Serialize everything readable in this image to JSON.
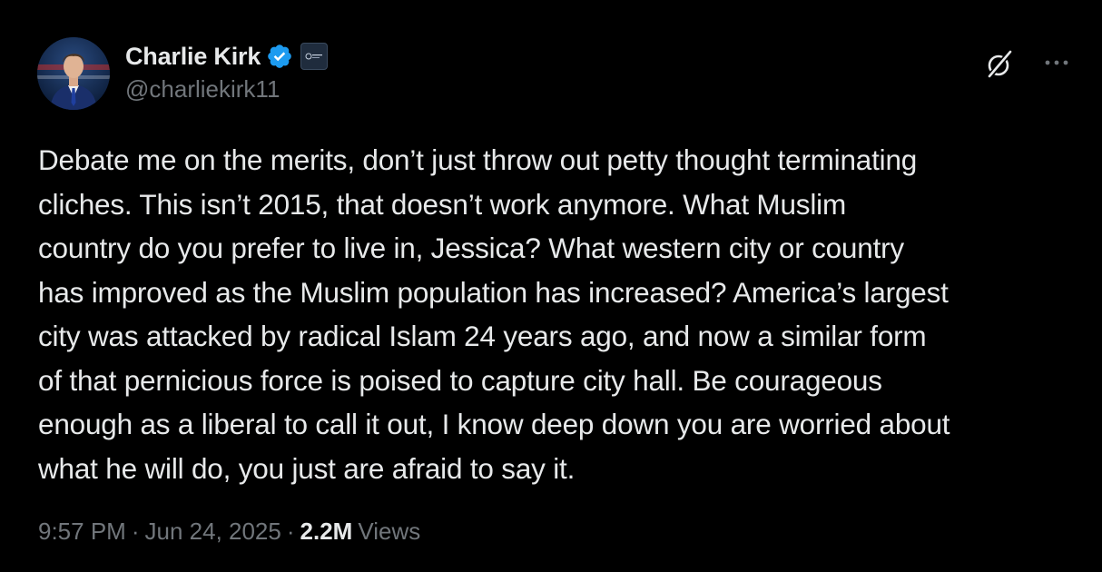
{
  "author": {
    "display_name": "Charlie Kirk",
    "handle": "@charliekirk11",
    "verified_badge_color": "#1d9bf0",
    "affiliate_badge_icon": "organization-badge-icon"
  },
  "icons": {
    "grok": "grok-slash-circle-icon",
    "more": "more-horizontal-icon"
  },
  "tweet": {
    "lines": [
      "Debate me on the merits, don’t just throw out petty thought terminating",
      "cliches. This isn’t 2015, that doesn’t work anymore. What Muslim",
      "country do you prefer to live in, Jessica? What western city or country",
      "has improved as the Muslim population has increased? America’s largest",
      "city was attacked by radical Islam 24 years ago, and now a similar form",
      "of that pernicious force is poised to capture city hall. Be courageous",
      "enough as a liberal to call it out, I know deep down you are worried about",
      "what he will do, you just are afraid to say it."
    ]
  },
  "meta": {
    "time": "9:57 PM",
    "separator": "·",
    "date": "Jun 24, 2025",
    "views_count": "2.2M",
    "views_label": "Views"
  },
  "colors": {
    "background": "#000000",
    "primary_text": "#e7e9ea",
    "secondary_text": "#71767b"
  }
}
